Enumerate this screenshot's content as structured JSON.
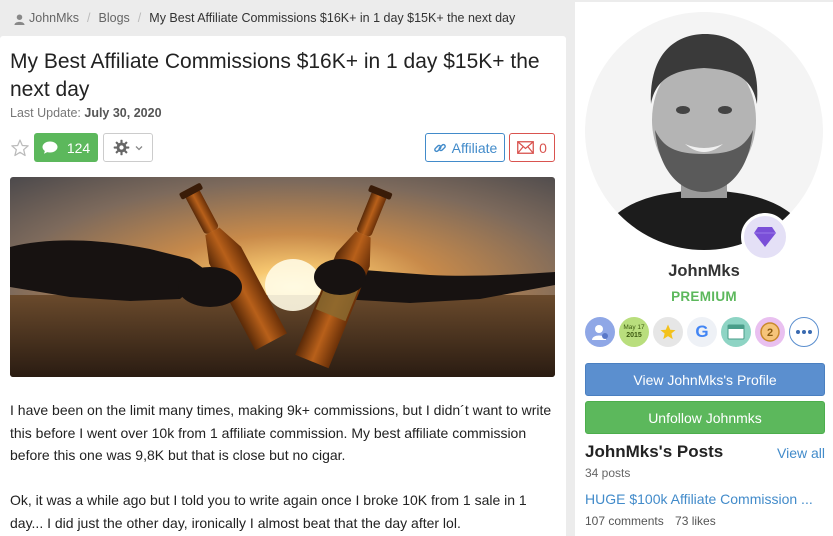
{
  "breadcrumb": {
    "user": "JohnMks",
    "section": "Blogs",
    "current": "My Best Affiliate Commissions $16K+ in 1 day $15K+ the next day"
  },
  "article": {
    "title": "My Best Affiliate Commissions $16K+ in 1 day $15K+ the next day",
    "last_update_label": "Last Update:",
    "last_update_date": "July 30, 2020",
    "comments_count": "124",
    "affiliate_label": "Affiliate",
    "mail_count": "0",
    "paragraphs": [
      "I have been on the limit many times, making 9k+ commissions, but I didn´t want to write this before I went over 10k from 1 affiliate commission. My best affiliate commission before this one was 9,8K but that is close but no cigar.",
      "Ok, it was a while ago but I told you to write again once I broke 10K from 1 sale in 1 day... I did just the other day, ironically I almost beat that the day after lol."
    ]
  },
  "profile": {
    "name": "JohnMks",
    "status": "PREMIUM",
    "badges": [
      {
        "icon": "user-settings-badge-icon"
      },
      {
        "icon": "join-date-badge-icon",
        "line1": "May 17",
        "line2": "2015"
      },
      {
        "icon": "star-badge-icon"
      },
      {
        "icon": "google-badge-icon",
        "letter": "G"
      },
      {
        "icon": "website-badge-icon"
      },
      {
        "icon": "rank-2-badge-icon",
        "number": "2"
      },
      {
        "icon": "more-badges-icon"
      }
    ],
    "view_profile_label": "View JohnMks's Profile",
    "unfollow_label": "Unfollow Johnmks"
  },
  "posts": {
    "title": "JohnMks's Posts",
    "view_all": "View all",
    "count": "34 posts",
    "latest": {
      "title": "HUGE $100k Affiliate Commission ...",
      "comments": "107 comments",
      "likes": "73 likes"
    }
  },
  "colors": {
    "green": "#5cb85c",
    "blue": "#428bca",
    "red": "#d9534f",
    "premium_gem": "#7a4fd8"
  }
}
